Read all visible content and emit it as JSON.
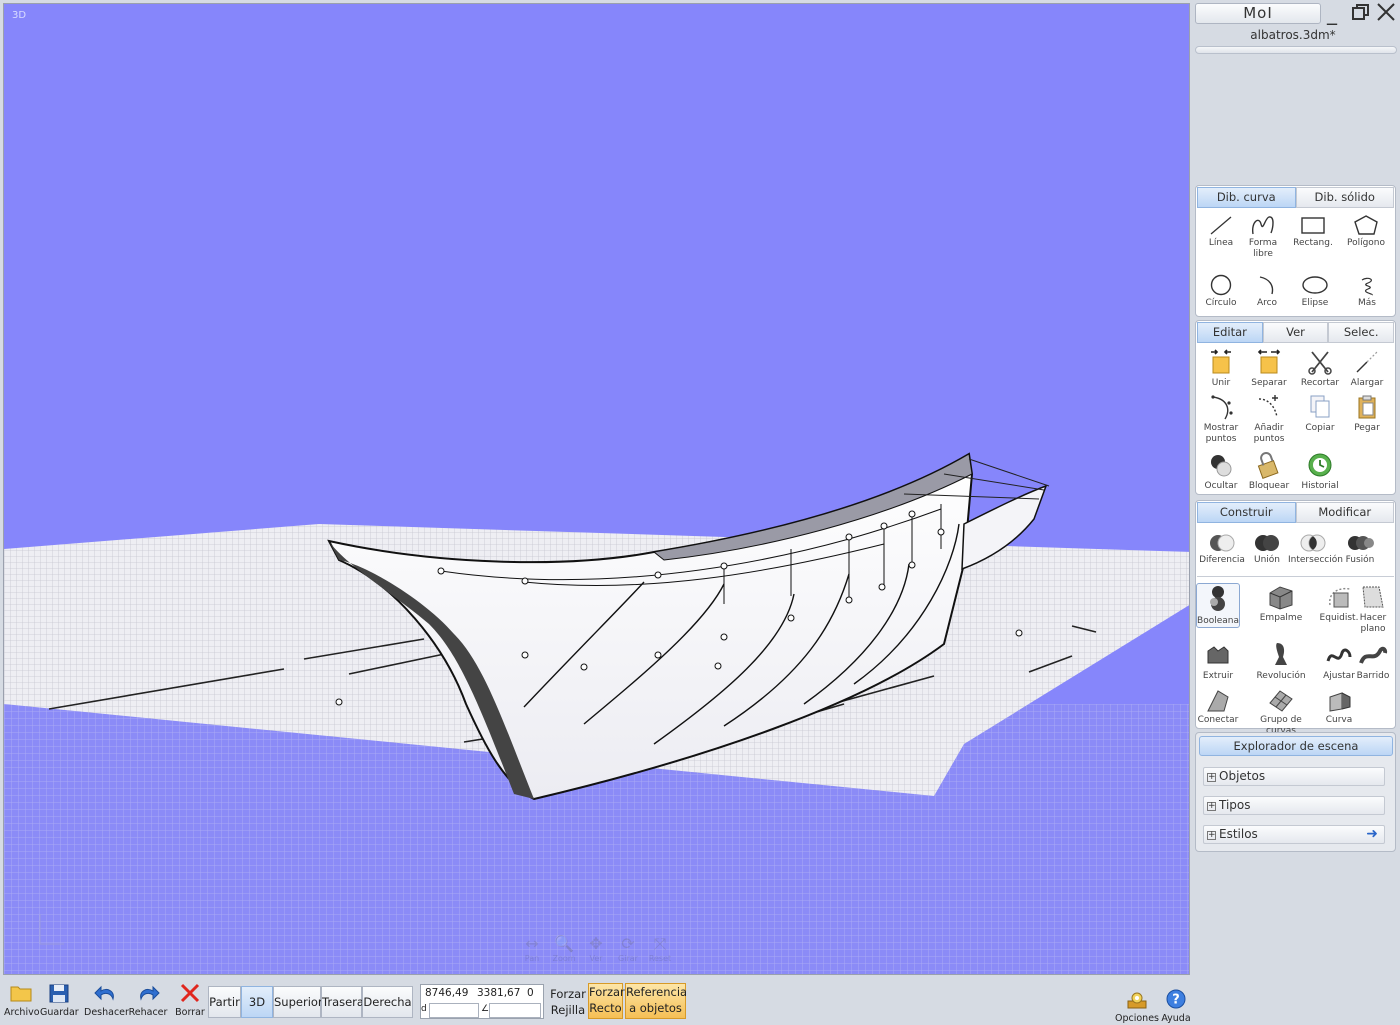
{
  "viewport": {
    "label": "3D",
    "nav_buttons": [
      "Pan",
      "Zoom",
      "Ver",
      "Girar",
      "Reset"
    ]
  },
  "window": {
    "app_name": "MoI",
    "file_name": "albatros.3dm*"
  },
  "draw_group": {
    "tabs": [
      {
        "label": "Dib. curva",
        "active": true
      },
      {
        "label": "Dib. sólido",
        "active": false
      }
    ],
    "tools": [
      {
        "label": "Línea",
        "icon": "line-icon"
      },
      {
        "label": "Forma libre",
        "icon": "freeform-icon"
      },
      {
        "label": "Rectang.",
        "icon": "rectangle-icon"
      },
      {
        "label": "Polígono",
        "icon": "polygon-icon"
      },
      {
        "label": "Círculo",
        "icon": "circle-icon"
      },
      {
        "label": "Arco",
        "icon": "arc-icon"
      },
      {
        "label": "Elipse",
        "icon": "ellipse-icon"
      },
      {
        "label": "Más",
        "icon": "more-icon"
      }
    ]
  },
  "edit_group": {
    "tabs": [
      {
        "label": "Editar",
        "active": true
      },
      {
        "label": "Ver",
        "active": false
      },
      {
        "label": "Selec.",
        "active": false
      }
    ],
    "tools": [
      {
        "label": "Unir",
        "icon": "join-icon"
      },
      {
        "label": "Separar",
        "icon": "separate-icon"
      },
      {
        "label": "Recortar",
        "icon": "trim-icon"
      },
      {
        "label": "Alargar",
        "icon": "extend-icon"
      },
      {
        "label": "Mostrar puntos",
        "icon": "show-points-icon"
      },
      {
        "label": "Añadir puntos",
        "icon": "add-points-icon"
      },
      {
        "label": "Copiar",
        "icon": "copy-icon"
      },
      {
        "label": "Pegar",
        "icon": "paste-icon"
      },
      {
        "label": "Ocultar",
        "icon": "hide-icon"
      },
      {
        "label": "Bloquear",
        "icon": "lock-icon"
      },
      {
        "label": "Historial",
        "icon": "history-icon"
      }
    ]
  },
  "build_group": {
    "tabs": [
      {
        "label": "Construir",
        "active": true
      },
      {
        "label": "Modificar",
        "active": false
      }
    ],
    "boolean_tools": [
      {
        "label": "Diferencia",
        "icon": "difference-icon"
      },
      {
        "label": "Unión",
        "icon": "union-icon"
      },
      {
        "label": "Intersección",
        "icon": "intersection-icon"
      },
      {
        "label": "Fusión",
        "icon": "merge-icon"
      }
    ],
    "tools": [
      {
        "label": "Booleana",
        "icon": "boolean-icon"
      },
      {
        "label": "Empalme",
        "icon": "fillet-icon"
      },
      {
        "label": "Equidist.",
        "icon": "offset-icon"
      },
      {
        "label": "Hacer plano",
        "icon": "planar-icon"
      },
      {
        "label": "Extruir",
        "icon": "extrude-icon"
      },
      {
        "label": "Revolución",
        "icon": "revolve-icon"
      },
      {
        "label": "Ajustar",
        "icon": "loft-icon"
      },
      {
        "label": "Barrido",
        "icon": "sweep-icon"
      },
      {
        "label": "Conectar",
        "icon": "blend-icon"
      },
      {
        "label": "Grupo de curvas",
        "icon": "network-icon"
      },
      {
        "label": "Curva",
        "icon": "curve-icon"
      }
    ]
  },
  "scene_explorer": {
    "title": "Explorador de escena",
    "rows": [
      {
        "label": "Objetos"
      },
      {
        "label": "Tipos"
      },
      {
        "label": "Estilos"
      }
    ]
  },
  "bottom_bar": {
    "file_tools": [
      {
        "label": "Archivo",
        "icon": "folder-icon"
      },
      {
        "label": "Guardar",
        "icon": "save-icon"
      },
      {
        "label": "Deshacer",
        "icon": "undo-icon"
      },
      {
        "label": "Rehacer",
        "icon": "redo-icon"
      },
      {
        "label": "Borrar",
        "icon": "delete-icon"
      }
    ],
    "view_buttons": [
      {
        "label": "Partir",
        "active": false
      },
      {
        "label": "3D",
        "active": true
      },
      {
        "label": "Superior",
        "active": false
      },
      {
        "label": "Trasera",
        "active": false
      },
      {
        "label": "Derecha",
        "active": false
      }
    ],
    "coords": {
      "x": "8746,49",
      "y": "3381,67",
      "z": "0",
      "distance_label": "d",
      "angle_label": "∠"
    },
    "snap_labels": {
      "forzar": "Forzar",
      "rejilla": "Rejilla"
    },
    "snap_buttons": [
      {
        "line1": "Forzar",
        "line2": "Recto"
      },
      {
        "line1": "Referencia",
        "line2": "a objetos"
      }
    ],
    "right_tools": [
      {
        "label": "Opciones",
        "icon": "options-icon"
      },
      {
        "label": "Ayuda",
        "icon": "help-icon"
      }
    ]
  },
  "colors": {
    "viewport_bg": "#8686fb",
    "panel_bg": "#d6dbe3",
    "active_tab": "#bcd6f5",
    "snap_orange": "#f5bf55"
  }
}
